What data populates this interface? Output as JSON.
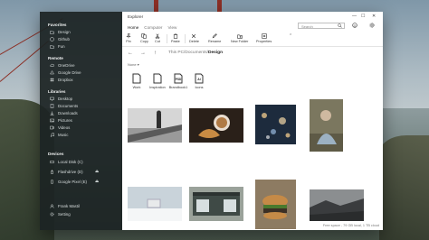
{
  "window": {
    "title": "Explorer",
    "tabs": [
      {
        "label": "Home",
        "active": true
      },
      {
        "label": "Computer",
        "active": false
      },
      {
        "label": "View",
        "active": false
      }
    ],
    "search_placeholder": "Search",
    "minimize_glyph": "—",
    "maximize_glyph": "☐",
    "close_glyph": "✕"
  },
  "ribbon": {
    "actions": [
      {
        "label": "Pin",
        "icon": "pin-icon"
      },
      {
        "label": "Copy",
        "icon": "copy-icon"
      },
      {
        "label": "Cut",
        "icon": "cut-icon"
      },
      {
        "label": "Paste",
        "icon": "paste-icon"
      },
      {
        "label": "Delete",
        "icon": "delete-icon"
      },
      {
        "label": "Rename",
        "icon": "rename-icon"
      },
      {
        "label": "New Folder",
        "icon": "new-folder-icon"
      },
      {
        "label": "Properties",
        "icon": "properties-icon"
      }
    ],
    "collapse_glyph": "⌃"
  },
  "address": {
    "path_prefix": "This PC/Documents/",
    "current": "Design"
  },
  "sidebar": {
    "favorites": {
      "title": "Favorites",
      "items": [
        {
          "label": "Design",
          "icon": "folder-icon"
        },
        {
          "label": "Github",
          "icon": "github-icon"
        },
        {
          "label": "Fun",
          "icon": "folder-icon"
        }
      ]
    },
    "remote": {
      "title": "Remote",
      "items": [
        {
          "label": "OneDrive",
          "icon": "onedrive-icon"
        },
        {
          "label": "Google Drive",
          "icon": "google-drive-icon"
        },
        {
          "label": "Dropbox",
          "icon": "dropbox-icon"
        }
      ]
    },
    "libraries": {
      "title": "Libraries",
      "items": [
        {
          "label": "Desktop",
          "icon": "desktop-icon"
        },
        {
          "label": "Documents",
          "icon": "documents-icon"
        },
        {
          "label": "Downloads",
          "icon": "downloads-icon"
        },
        {
          "label": "Pictures",
          "icon": "pictures-icon"
        },
        {
          "label": "Videos",
          "icon": "videos-icon"
        },
        {
          "label": "Music",
          "icon": "music-icon"
        }
      ]
    },
    "devices": {
      "title": "Devices",
      "items": [
        {
          "label": "Local Disk (C)",
          "icon": "disk-icon",
          "ejectable": false
        },
        {
          "label": "Flashdrive (D)",
          "icon": "usb-icon",
          "ejectable": true
        },
        {
          "label": "Google Pixel (E)",
          "icon": "phone-icon",
          "ejectable": true
        }
      ]
    },
    "user": {
      "label": "Frank Mastil",
      "icon": "user-icon"
    },
    "settings": {
      "label": "Setting",
      "icon": "gear-icon"
    },
    "eject_glyph": "⏏"
  },
  "content": {
    "section_label": "None",
    "folders": [
      {
        "label": "Work",
        "icon": "document-icon",
        "badge": ""
      },
      {
        "label": "Inspiration",
        "icon": "document-icon",
        "badge": ""
      },
      {
        "label": "Brandbook1",
        "icon": "psd-file-icon",
        "badge": "PSD"
      },
      {
        "label": "Icons",
        "icon": "ai-file-icon",
        "badge": "Ai"
      }
    ],
    "photos": [
      {
        "name": "photo-person-standing",
        "colors": [
          "#d9d9d9",
          "#3a3a3a"
        ]
      },
      {
        "name": "photo-coffee-croissant",
        "colors": [
          "#2a2019",
          "#c98b43"
        ]
      },
      {
        "name": "photo-city-bokeh",
        "colors": [
          "#1d2b3d",
          "#e6c38a"
        ]
      },
      {
        "name": "photo-woman-portrait",
        "colors": [
          "#6d6b5a",
          "#dcd2c0"
        ]
      },
      {
        "name": "photo-white-desk",
        "colors": [
          "#c9d3da",
          "#ffffff"
        ]
      },
      {
        "name": "photo-storefront",
        "colors": [
          "#9aa29a",
          "#3f4a46"
        ]
      },
      {
        "name": "photo-burger",
        "colors": [
          "#8d7b62",
          "#3b2f25"
        ]
      },
      {
        "name": "photo-dark-landscape",
        "colors": [
          "#6d6f70",
          "#2f3133"
        ]
      }
    ],
    "status": "Free space - 79 GB local, 1 TB cloud"
  },
  "colors": {
    "sidebar_bg": "#1c2424",
    "main_bg": "#ffffff",
    "bridge": "#8c2f25"
  }
}
